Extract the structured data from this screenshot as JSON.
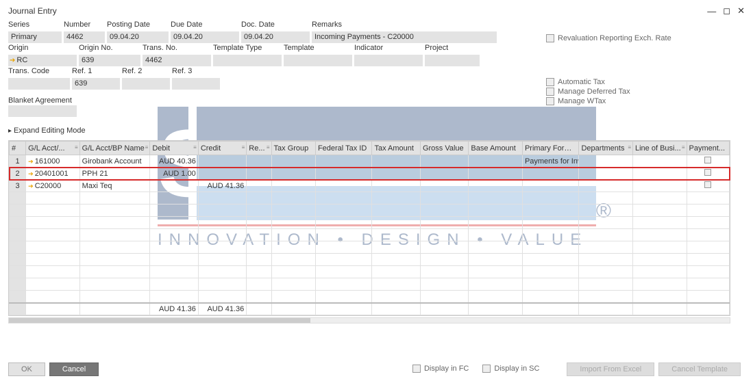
{
  "window": {
    "title": "Journal Entry"
  },
  "fields": {
    "series_label": "Series",
    "series": "Primary",
    "number_label": "Number",
    "number": "4462",
    "posting_date_label": "Posting Date",
    "posting_date": "09.04.20",
    "due_date_label": "Due Date",
    "due_date": "09.04.20",
    "doc_date_label": "Doc. Date",
    "doc_date": "09.04.20",
    "remarks_label": "Remarks",
    "remarks": "Incoming Payments - C20000",
    "origin_label": "Origin",
    "origin": "RC",
    "origin_no_label": "Origin No.",
    "origin_no": "639",
    "trans_no_label": "Trans. No.",
    "trans_no": "4462",
    "template_type_label": "Template Type",
    "template_type": "",
    "template_label": "Template",
    "template": "",
    "indicator_label": "Indicator",
    "indicator": "",
    "project_label": "Project",
    "project": "",
    "trans_code_label": "Trans. Code",
    "trans_code": "",
    "ref1_label": "Ref. 1",
    "ref1": "639",
    "ref2_label": "Ref. 2",
    "ref2": "",
    "ref3_label": "Ref. 3",
    "ref3": ""
  },
  "right": {
    "reval": "Revaluation Reporting Exch. Rate",
    "auto_tax": "Automatic Tax",
    "deferred": "Manage Deferred Tax",
    "wtax": "Manage WTax"
  },
  "blanket_label": "Blanket Agreement",
  "expand_label": "Expand Editing Mode",
  "columns": {
    "c0": "#",
    "c1": "G/L Acct/...",
    "c2": "G/L Acct/BP Name",
    "c3": "Debit",
    "c4": "Credit",
    "c5": "Re...",
    "c6": "Tax Group",
    "c7": "Federal Tax ID",
    "c8": "Tax Amount",
    "c9": "Gross Value",
    "c10": "Base Amount",
    "c11": "Primary Form...",
    "c12": "Departments",
    "c13": "Line of Busi...",
    "c14": "Payment..."
  },
  "rows": [
    {
      "n": "1",
      "acct": "161000",
      "name": "Girobank Account",
      "debit": "AUD 40.36",
      "credit": "",
      "primary": "Payments for Inv"
    },
    {
      "n": "2",
      "acct": "20401001",
      "name": "PPH 21",
      "debit": "AUD 1.00",
      "credit": "",
      "primary": ""
    },
    {
      "n": "3",
      "acct": "C20000",
      "name": "Maxi Teq",
      "debit": "",
      "credit": "AUD 41.36",
      "primary": ""
    }
  ],
  "totals": {
    "debit": "AUD 41.36",
    "credit": "AUD 41.36"
  },
  "bottom": {
    "ok": "OK",
    "cancel": "Cancel",
    "display_fc": "Display in FC",
    "display_sc": "Display in SC",
    "import": "Import From Excel",
    "cancel_tpl": "Cancel Template"
  }
}
